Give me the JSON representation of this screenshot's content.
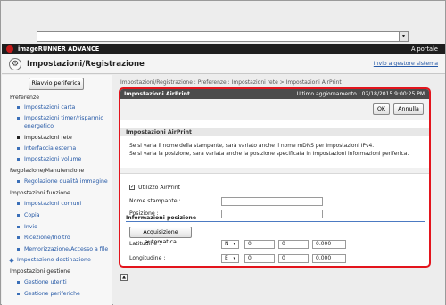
{
  "brand": {
    "title": "imageRUNNER ADVANCE",
    "portal_link": "A portale"
  },
  "header": {
    "title": "Impostazioni/Registrazione",
    "link": "Invio a gestore sistema"
  },
  "sidebar": {
    "restart_button": "Riavvio periferica",
    "sections": [
      {
        "label": "Preferenze",
        "items": [
          "Impostazioni carta",
          "Impostazioni timer/risparmio",
          "energetico",
          "Impostazioni rete",
          "Interfaccia esterna",
          "Impostazioni volume"
        ]
      },
      {
        "label": "Regolazione/Manutenzione",
        "items": [
          "Regolazione qualità immagine"
        ]
      },
      {
        "label": "Impostazioni funzione",
        "items": [
          "Impostazioni comuni",
          "Copia",
          "Invio",
          "Ricezione/Inoltro",
          "Memorizzazione/Accesso a file"
        ]
      },
      {
        "label": "Impostazione destinazione",
        "items": []
      },
      {
        "label": "Impostazioni gestione",
        "items": [
          "Gestione utenti",
          "Gestione periferiche"
        ]
      }
    ],
    "active_item": "Impostazioni rete"
  },
  "breadcrumb": "Impostazioni/Registrazione : Preferenze : Impostazioni rete > Impostazioni AirPrint",
  "panel": {
    "title": "Impostazioni AirPrint",
    "last_update": "Ultimo aggiornamento : 02/18/2015 9:00:25 PM",
    "ok_button": "OK",
    "cancel_button": "Annulla",
    "section_title": "Impostazioni AirPrint",
    "note_line1": "Se si varia il nome della stampante, sarà variato anche il nome mDNS per Impostazioni IPv4.",
    "note_line2": "Se si varia la posizione, sarà variata anche la posizione specificata in Impostazioni informazioni periferica.",
    "use_airprint_label": "Utilizzo AirPrint",
    "use_airprint_checked": true,
    "printer_name_label": "Nome stampante :",
    "printer_name_value": "",
    "location_label": "Posizione :",
    "location_value": "",
    "position_info_title": "Informazioni posizione",
    "acquire_button": "Acquisizione automatica",
    "latitude_label": "Latitudine :",
    "latitude": {
      "dir": "N",
      "deg": "0",
      "min": "0",
      "sec": "0.000"
    },
    "longitude_label": "Longitudine :",
    "longitude": {
      "dir": "E",
      "deg": "0",
      "min": "0",
      "sec": "0.000"
    }
  },
  "icons": {
    "checkmark": "✓",
    "dropdown": "▾",
    "to_top": "▲"
  },
  "colors": {
    "accent_red": "#e3141c",
    "link_blue": "#2458a6",
    "title_bar": "#4c4c4c"
  }
}
